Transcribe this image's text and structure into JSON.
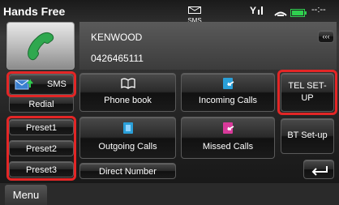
{
  "header": {
    "title": "Hands Free",
    "sms_indicator": "SMS",
    "clock": "--:--"
  },
  "device": {
    "name": "KENWOOD",
    "number": "0426465111"
  },
  "left_column": {
    "sms_label": "SMS",
    "redial_label": "Redial",
    "preset1_label": "Preset1",
    "preset2_label": "Preset2",
    "preset3_label": "Preset3"
  },
  "grid": {
    "phone_book_label": "Phone book",
    "incoming_calls_label": "Incoming Calls",
    "outgoing_calls_label": "Outgoing Calls",
    "missed_calls_label": "Missed Calls",
    "direct_number_label": "Direct Number"
  },
  "right_column": {
    "tel_setup_label": "TEL SET-UP",
    "bt_setup_label": "BT Set-up"
  },
  "footer": {
    "menu_label": "Menu"
  },
  "icons": {
    "call": "phone-handset-icon",
    "sms": "sms-envelope-icon",
    "phone_book": "open-book-icon",
    "incoming": "incoming-calls-icon",
    "outgoing": "outgoing-calls-icon",
    "missed": "missed-calls-icon",
    "back": "return-arrow-icon",
    "signal": "signal-strength-icon",
    "battery": "battery-icon"
  },
  "colors": {
    "highlight": "#e32626",
    "call_green": "#2fa84f",
    "incoming_blue": "#2a9fd8",
    "missed_pink": "#d83a9a"
  }
}
